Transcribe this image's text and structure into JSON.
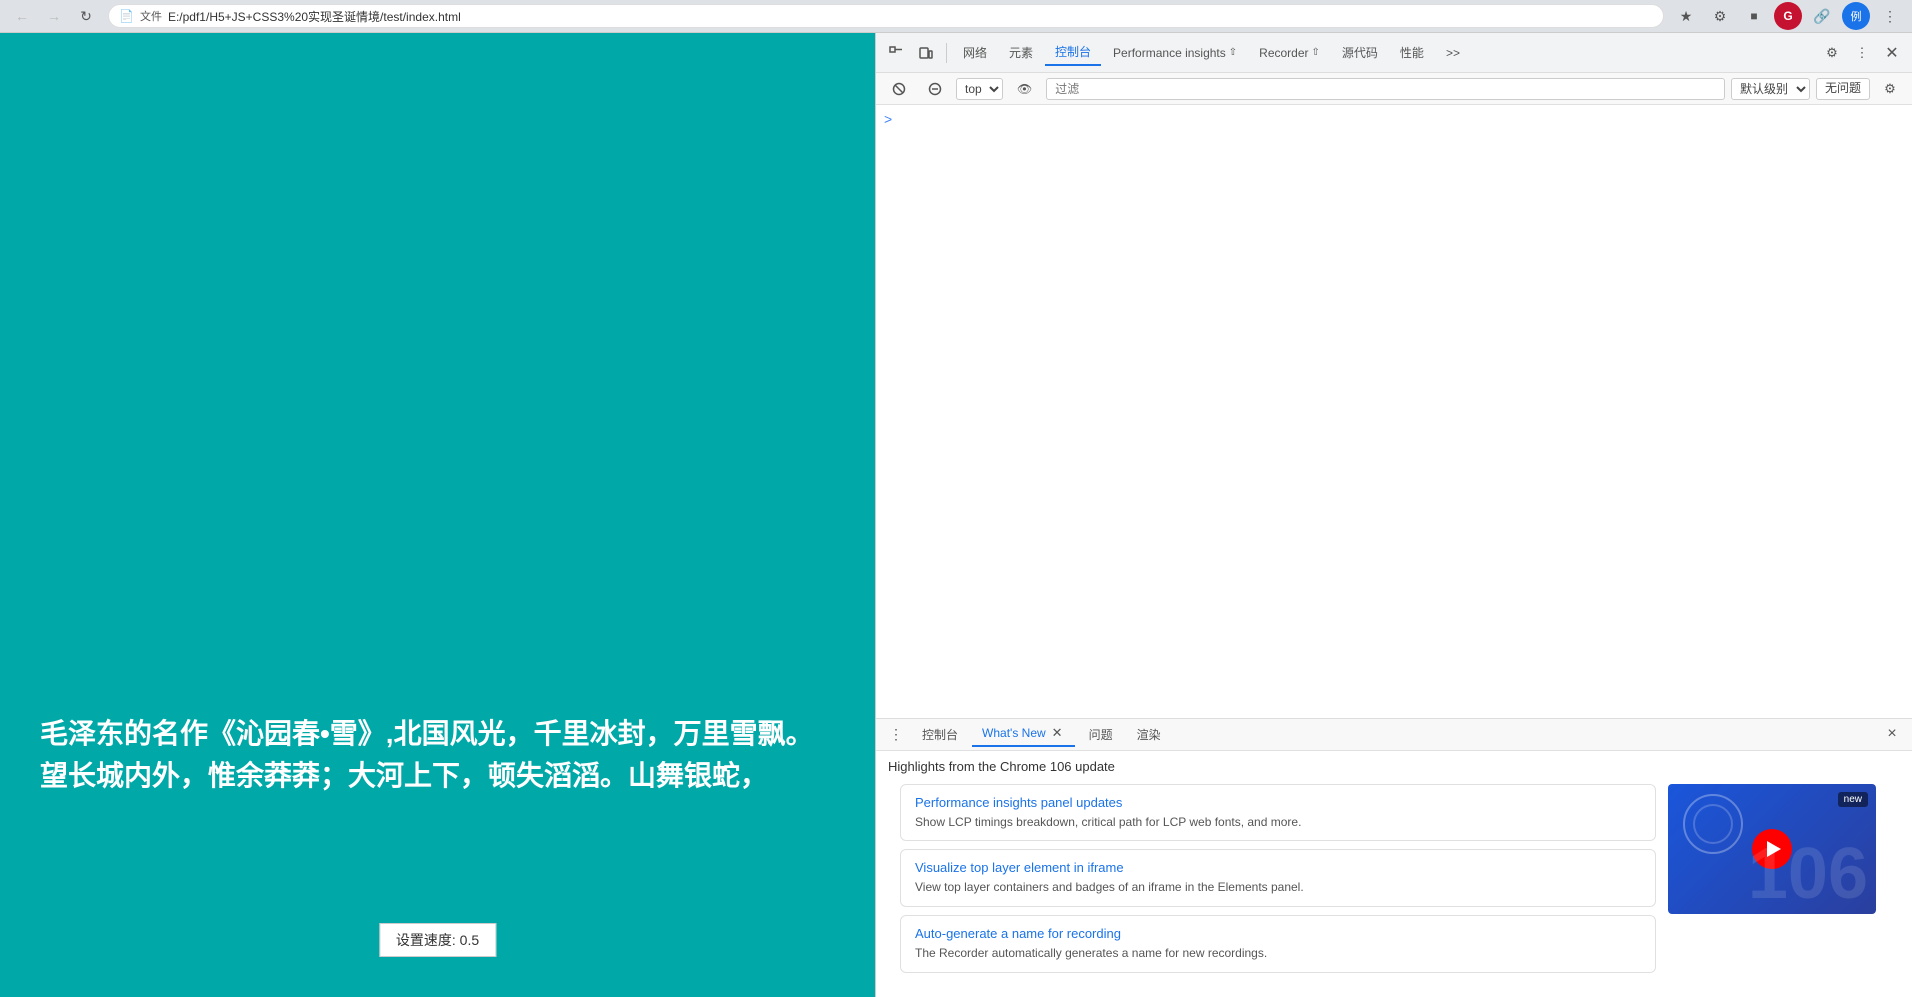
{
  "browser": {
    "title": "test/index.html",
    "address": "E:/pdf1/H5+JS+CSS3%20实现圣诞情境/test/index.html",
    "protocol": "文件",
    "nav": {
      "back": "←",
      "forward": "→",
      "reload": "↺"
    }
  },
  "webpage": {
    "bg_color": "#00a8a8",
    "text_line1": "毛泽东的名作《沁园春•雪》,北国风光，千里冰封，万里雪飘。",
    "text_line2": "望长城内外，惟余莽莽；大河上下，顿失滔滔。山舞银蛇，",
    "speed_label": "设置速度: 0.5"
  },
  "devtools": {
    "tabs": [
      {
        "id": "elements",
        "label": "网络"
      },
      {
        "id": "network",
        "label": "元素"
      },
      {
        "id": "console",
        "label": "控制台",
        "active": true
      },
      {
        "id": "performance_insights",
        "label": "Performance insights",
        "has_upload": true
      },
      {
        "id": "recorder",
        "label": "Recorder",
        "has_upload": true
      },
      {
        "id": "sources",
        "label": "源代码"
      },
      {
        "id": "performance",
        "label": "性能"
      },
      {
        "id": "more",
        "label": ">>"
      }
    ],
    "settings_icon": "⚙",
    "more_icon": "⋮",
    "toolbar2": {
      "top_selector": "top",
      "eye_label": "👁",
      "filter_placeholder": "过滤",
      "level_label": "默认级别",
      "issues_label": "无问题"
    }
  },
  "drawer": {
    "tabs": [
      {
        "id": "console_tab",
        "label": "控制台"
      },
      {
        "id": "whats_new",
        "label": "What's New",
        "active": true,
        "closeable": true
      },
      {
        "id": "issues",
        "label": "问题"
      },
      {
        "id": "rendering",
        "label": "渲染"
      }
    ],
    "close_btn": "×",
    "whats_new": {
      "header": "Highlights from the Chrome 106 update",
      "items": [
        {
          "title": "Performance insights panel updates",
          "description": "Show LCP timings breakdown, critical path for LCP web fonts, and more."
        },
        {
          "title": "Visualize top layer element in iframe",
          "description": "View top layer containers and badges of an iframe in the Elements panel."
        },
        {
          "title": "Auto-generate a name for recording",
          "description": "The Recorder automatically generates a name for new recordings."
        }
      ],
      "video": {
        "badge": "new",
        "number": "106"
      }
    }
  },
  "console_prompt": {
    "arrow": ">"
  }
}
